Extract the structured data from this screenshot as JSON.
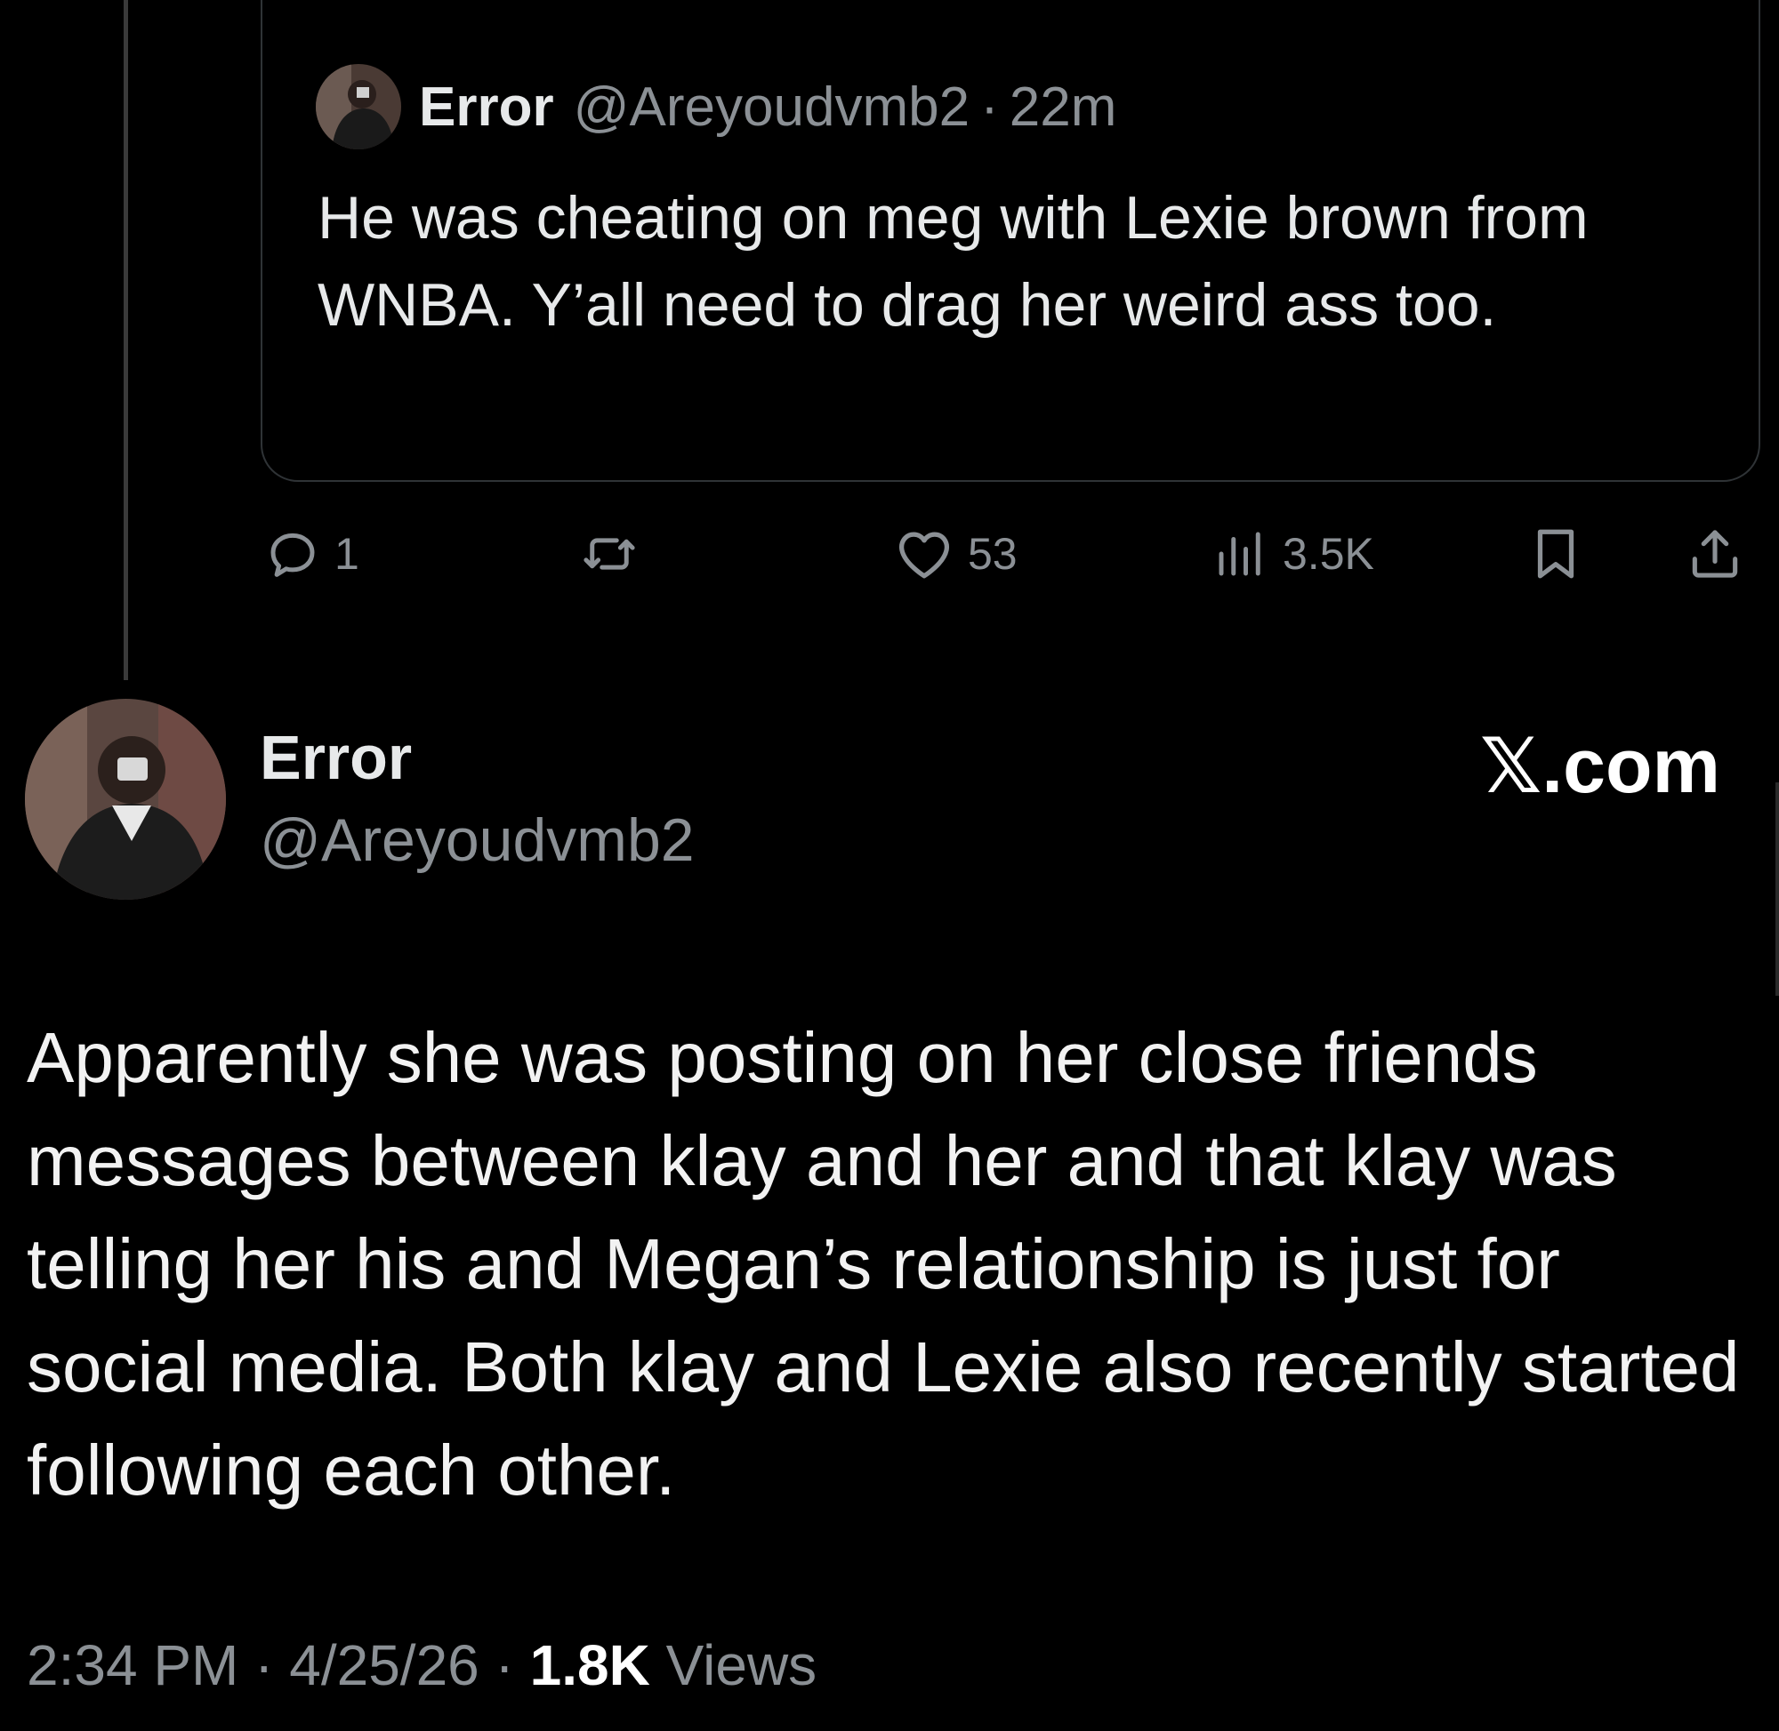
{
  "quoted_tweet": {
    "author_name": "Error",
    "handle": "@Areyoudvmb2",
    "separator": "·",
    "time_ago": "22m",
    "text": "He was cheating on meg with Lexie brown from WNBA. Y’all need to drag her weird ass too.",
    "actions": {
      "reply": {
        "icon": "reply-icon",
        "count": "1"
      },
      "retweet": {
        "icon": "retweet-icon",
        "count": ""
      },
      "like": {
        "icon": "heart-icon",
        "count": "53"
      },
      "views": {
        "icon": "views-icon",
        "count": "3.5K"
      },
      "bookmark": {
        "icon": "bookmark-icon"
      },
      "share": {
        "icon": "share-icon"
      }
    }
  },
  "main_tweet": {
    "author_name": "Error",
    "handle": "@Areyoudvmb2",
    "brand": "𝕏.com",
    "text": "Apparently she was posting on her close friends messages between klay and her and that klay was telling her his and Megan’s relationship is just for social media. Both klay and Lexie also recently started following each other.",
    "time": "2:34 PM",
    "date": "4/25/26",
    "separator": "·",
    "views_count": "1.8K",
    "views_label": "Views"
  },
  "colors": {
    "background": "#000000",
    "primary_text": "#e7e9ea",
    "secondary_text": "#8b9095",
    "border": "#2f3336"
  }
}
